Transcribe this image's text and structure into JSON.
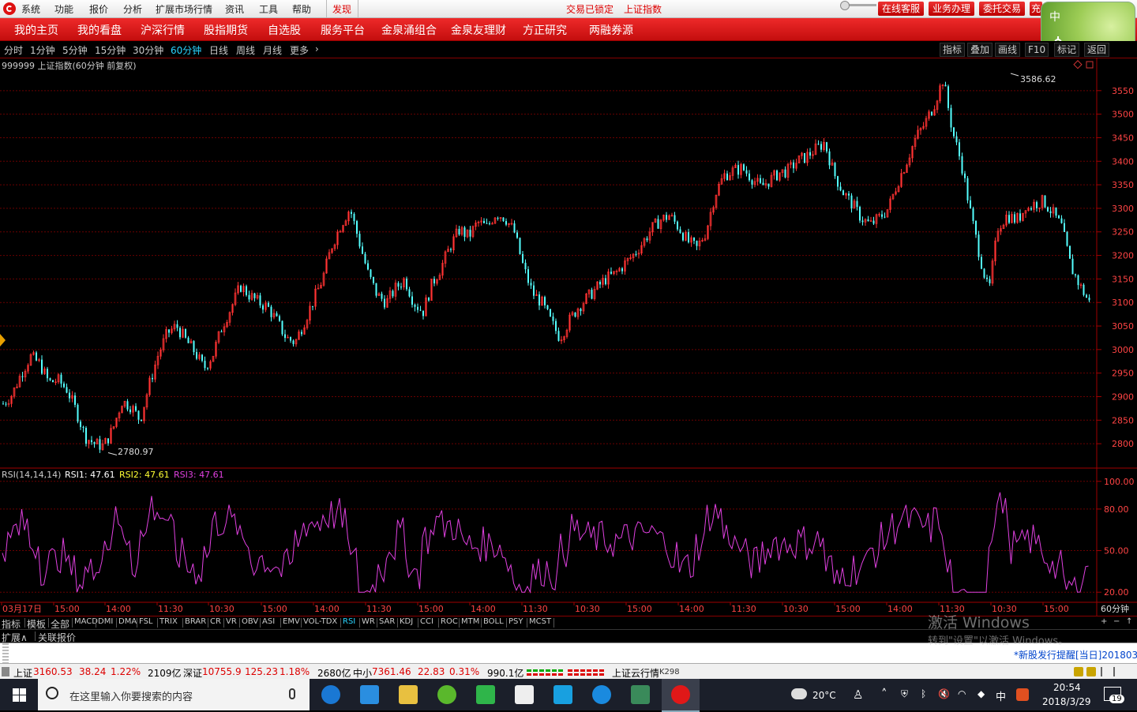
{
  "top_menu": {
    "items": [
      "系统",
      "功能",
      "报价",
      "分析",
      "扩展市场行情",
      "资讯",
      "工具",
      "帮助"
    ],
    "discover": "发现",
    "lock_text": "交易已锁定",
    "index_name": "上证指数",
    "buttons": [
      "在线客服",
      "业务办理",
      "委托交易",
      "充"
    ]
  },
  "nav": {
    "items": [
      "我的主页",
      "我的看盘",
      "沪深行情",
      "股指期货",
      "自选股",
      "服务平台",
      "金泉涌组合",
      "金泉友理财",
      "方正研究",
      "两融券源"
    ]
  },
  "widget": {
    "label": "中",
    "icon": "gear-icon"
  },
  "period_bar": {
    "items": [
      "分时",
      "1分钟",
      "5分钟",
      "15分钟",
      "30分钟",
      "60分钟",
      "日线",
      "周线",
      "月线",
      "更多"
    ],
    "active": "60分钟",
    "more_arrow": "›",
    "right": [
      "指标",
      "叠加",
      "画线",
      "F10",
      "标记",
      "返回"
    ]
  },
  "chart_data": {
    "type": "candlestick",
    "title": "999999 上证指数(60分钟 前复权)",
    "high_label": "3586.62",
    "low_label": "2780.97",
    "y_ticks": [
      "3550",
      "3500",
      "3450",
      "3400",
      "3350",
      "3300",
      "3250",
      "3200",
      "3150",
      "3100",
      "3050",
      "3000",
      "2950",
      "2900",
      "2850",
      "2800"
    ],
    "ylim": [
      2765,
      3600
    ],
    "close_series": [
      2885,
      2905,
      2950,
      2985,
      2970,
      2930,
      2935,
      2915,
      2870,
      2815,
      2800,
      2795,
      2830,
      2890,
      2880,
      2850,
      2925,
      2990,
      3035,
      3050,
      3020,
      2995,
      2960,
      2990,
      3050,
      3090,
      3135,
      3115,
      3100,
      3090,
      3060,
      3025,
      3015,
      3060,
      3105,
      3150,
      3220,
      3265,
      3300,
      3230,
      3160,
      3115,
      3100,
      3130,
      3150,
      3100,
      3080,
      3140,
      3175,
      3220,
      3255,
      3240,
      3270,
      3260,
      3290,
      3280,
      3250,
      3175,
      3120,
      3100,
      3060,
      3025,
      3060,
      3090,
      3110,
      3130,
      3150,
      3160,
      3180,
      3200,
      3225,
      3255,
      3275,
      3285,
      3260,
      3230,
      3215,
      3250,
      3330,
      3370,
      3380,
      3385,
      3365,
      3345,
      3360,
      3375,
      3380,
      3400,
      3410,
      3425,
      3440,
      3375,
      3335,
      3310,
      3280,
      3265,
      3280,
      3300,
      3355,
      3400,
      3450,
      3480,
      3520,
      3575,
      3465,
      3395,
      3290,
      3200,
      3120,
      3260,
      3285,
      3275,
      3295,
      3310,
      3315,
      3290,
      3260,
      3175,
      3135,
      3100
    ],
    "rsi_title": "RSI(14,14,14)",
    "rsi_labels": [
      "RSI1: 47.61",
      "RSI2: 47.61",
      "RSI3: 47.61"
    ],
    "rsi_ticks": [
      "100.00",
      "80.00",
      "50.00",
      "20.00"
    ],
    "rsi_ylim": [
      15,
      105
    ],
    "x_ticks": [
      "03月17日",
      "15:00",
      "14:00",
      "11:30",
      "10:30",
      "15:00",
      "14:00",
      "11:30",
      "15:00",
      "14:00",
      "11:30",
      "10:30",
      "15:00",
      "14:00",
      "11:30",
      "10:30",
      "15:00",
      "14:00",
      "11:30",
      "10:30",
      "15:00"
    ],
    "period_label": "60分钟"
  },
  "indicator_tabs": {
    "items": [
      "指标",
      "模板",
      "全部",
      "MACD",
      "DMI",
      "DMA",
      "FSL",
      "TRIX",
      "BRAR",
      "CR",
      "VR",
      "OBV",
      "ASI",
      "EMV",
      "VOL-TDX",
      "RSI",
      "WR",
      "SAR",
      "KDJ",
      "CCI",
      "ROC",
      "MTM",
      "BOLL",
      "PSY",
      "MCST"
    ],
    "active": "RSI",
    "controls": [
      "+",
      "−",
      "↑"
    ]
  },
  "ext_bar": {
    "expand": "扩展∧",
    "related": "关联报价"
  },
  "ticker": {
    "text": "*新股发行提醒[当日]2018032"
  },
  "status": {
    "sh_name": "上证",
    "sh_val": "3160.53",
    "sh_chg": "38.24",
    "sh_pct": "1.22%",
    "sh_amt": "2109亿",
    "sz_name": "深证",
    "sz_val": "10755.9",
    "sz_chg": "125.23",
    "sz_pct": "1.18%",
    "sz_amt": "2680亿",
    "zx_name": "中小",
    "zx_val": "7361.46",
    "zx_chg": "22.83",
    "zx_pct": "0.31%",
    "zx_amt": "990.1亿",
    "cloud": "上证云行情",
    "cloud_num": "K298"
  },
  "watermark": {
    "line1": "激活 Windows",
    "line2": "转到\"设置\"以激活 Windows。"
  },
  "taskbar": {
    "search_placeholder": "在这里输入你要搜索的内容",
    "weather": "20°C",
    "ime": "中",
    "time": "20:54",
    "date": "2018/3/29",
    "notifications": "19"
  },
  "colors": {
    "up": "#ff3333",
    "down": "#54ffff",
    "rsi": "#e040e0",
    "grid": "#6a0000",
    "active": "#2ad4ff"
  }
}
